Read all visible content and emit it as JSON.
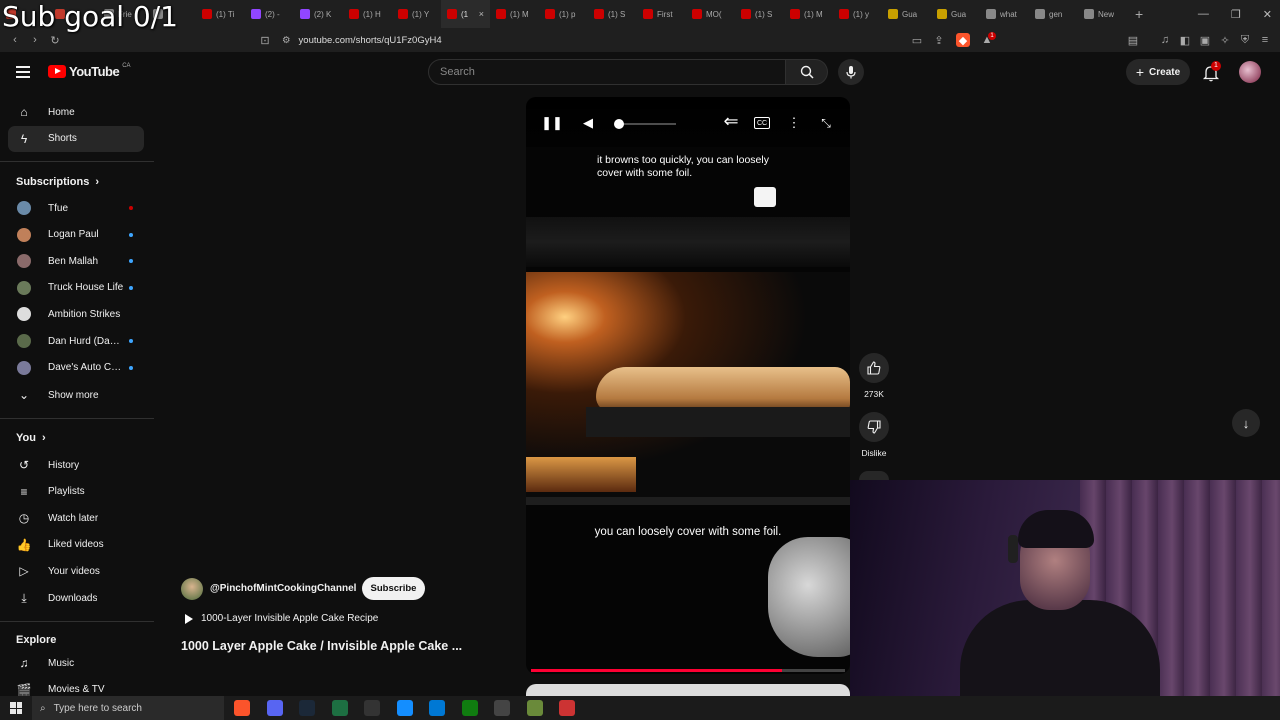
{
  "overlay": {
    "subgoal": "Sub goal 0/1"
  },
  "browser": {
    "tabs": [
      {
        "label": "",
        "color": "#c0392b"
      },
      {
        "label": "",
        "color": "#c0392b"
      },
      {
        "label": "Frie",
        "color": "#888"
      },
      {
        "label": "",
        "color": "#888"
      },
      {
        "label": "(1) Ti",
        "color": "#cc0000"
      },
      {
        "label": "(2) -",
        "color": "#9146ff"
      },
      {
        "label": "(2) K",
        "color": "#9146ff"
      },
      {
        "label": "(1) H",
        "color": "#cc0000"
      },
      {
        "label": "(1) Y",
        "color": "#cc0000"
      },
      {
        "label": "(1",
        "color": "#cc0000",
        "active": true
      },
      {
        "label": "(1) M",
        "color": "#cc0000"
      },
      {
        "label": "(1) p",
        "color": "#cc0000"
      },
      {
        "label": "(1) S",
        "color": "#cc0000"
      },
      {
        "label": "First",
        "color": "#cc0000"
      },
      {
        "label": "MO(",
        "color": "#cc0000"
      },
      {
        "label": "(1) S",
        "color": "#cc0000"
      },
      {
        "label": "(1) M",
        "color": "#cc0000"
      },
      {
        "label": "(1) y",
        "color": "#cc0000"
      },
      {
        "label": "Gua",
        "color": "#c8a000"
      },
      {
        "label": "Gua",
        "color": "#c8a000"
      },
      {
        "label": "what",
        "color": "#888"
      },
      {
        "label": "gen",
        "color": "#888"
      },
      {
        "label": "New",
        "color": "#888"
      }
    ],
    "tab_close": "×",
    "new_tab": "+",
    "window_controls": [
      "—",
      "❐",
      "✕"
    ],
    "url": "youtube.com/shorts/qU1Fz0GyH4",
    "shield_badge": "1"
  },
  "header": {
    "logo_text": "YouTube",
    "region": "CA",
    "search_placeholder": "Search",
    "create_label": "Create",
    "notifications_count": "1"
  },
  "sidebar": {
    "main": [
      {
        "label": "Home",
        "icon": "home-icon",
        "glyph": "⌂"
      },
      {
        "label": "Shorts",
        "icon": "shorts-icon",
        "glyph": "ϟ",
        "active": true
      }
    ],
    "subscriptions_title": "Subscriptions",
    "subscriptions": [
      {
        "label": "Tfue",
        "color": "#6a8aa8",
        "dot": "#cc0000"
      },
      {
        "label": "Logan Paul",
        "color": "#c0805a",
        "dot": "#3ea6ff"
      },
      {
        "label": "Ben Mallah",
        "color": "#8a6a6a",
        "dot": "#3ea6ff"
      },
      {
        "label": "Truck House Life",
        "color": "#6a7a5a",
        "dot": "#3ea6ff"
      },
      {
        "label": "Ambition Strikes",
        "color": "#ddd",
        "dot": ""
      },
      {
        "label": "Dan Hurd (Dan H...",
        "color": "#5a6a4a",
        "dot": "#3ea6ff"
      },
      {
        "label": "Dave's Auto Cent...",
        "color": "#7a7a9a",
        "dot": "#3ea6ff"
      }
    ],
    "show_more": "Show more",
    "you_title": "You",
    "you": [
      {
        "label": "History",
        "icon": "history-icon",
        "glyph": "↺"
      },
      {
        "label": "Playlists",
        "icon": "playlists-icon",
        "glyph": "≡"
      },
      {
        "label": "Watch later",
        "icon": "watch-later-icon",
        "glyph": "◷"
      },
      {
        "label": "Liked videos",
        "icon": "thumbs-up-icon",
        "glyph": "👍"
      },
      {
        "label": "Your videos",
        "icon": "your-videos-icon",
        "glyph": "▷"
      },
      {
        "label": "Downloads",
        "icon": "download-icon",
        "glyph": "⤓"
      }
    ],
    "explore_title": "Explore",
    "explore": [
      {
        "label": "Music",
        "icon": "music-icon",
        "glyph": "♫"
      },
      {
        "label": "Movies & TV",
        "icon": "movies-icon",
        "glyph": "🎬"
      }
    ]
  },
  "video": {
    "caption_top": "it browns too quickly, you can loosely cover with some foil.",
    "caption_mid": "you can loosely cover with some foil.",
    "progress": 0.8,
    "volume": 0.05,
    "cc_label": "CC"
  },
  "actions": {
    "like_count": "273K",
    "dislike_label": "Dislike"
  },
  "channel": {
    "name": "@PinchofMintCookingChannel",
    "subscribe_label": "Subscribe",
    "playlist": "1000-Layer Invisible Apple Cake Recipe",
    "title": "1000 Layer Apple Cake / Invisible Apple Cake ..."
  },
  "taskbar": {
    "search_placeholder": "Type here to search",
    "apps": [
      {
        "name": "brave-app-icon",
        "color": "#fb542b"
      },
      {
        "name": "discord-app-icon",
        "color": "#5865f2"
      },
      {
        "name": "steam-app-icon",
        "color": "#1b2838"
      },
      {
        "name": "excel-app-icon",
        "color": "#1d6f42"
      },
      {
        "name": "epic-app-icon",
        "color": "#333"
      },
      {
        "name": "battle-net-app-icon",
        "color": "#148eff"
      },
      {
        "name": "explorer-app-icon",
        "color": "#0078d4"
      },
      {
        "name": "xbox-app-icon",
        "color": "#107c10"
      },
      {
        "name": "valorant-app-icon",
        "color": "#444"
      },
      {
        "name": "minecraft-app-icon",
        "color": "#6a8a3a"
      },
      {
        "name": "obs-app-icon",
        "color": "#c33"
      }
    ]
  }
}
